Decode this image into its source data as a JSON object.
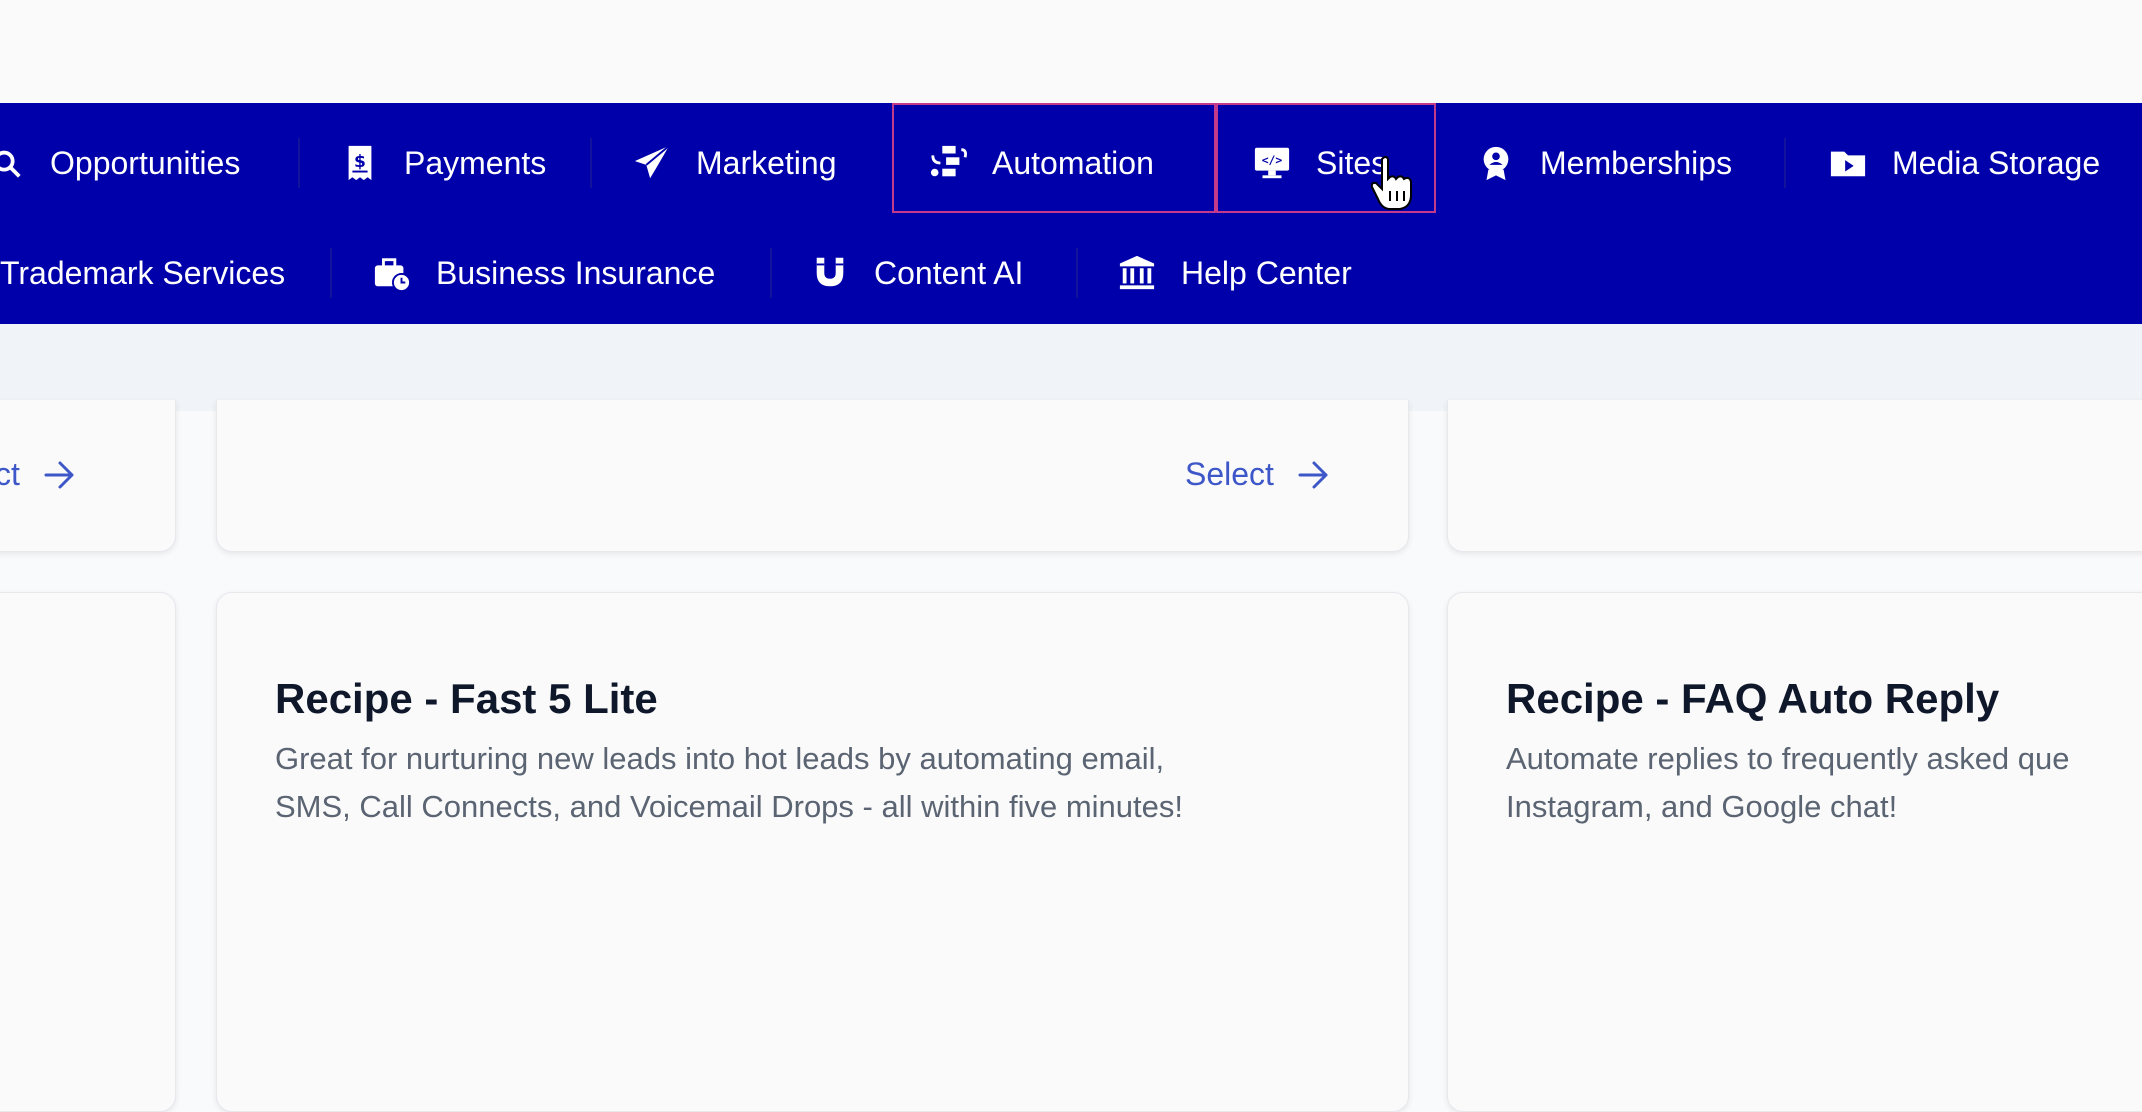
{
  "nav": {
    "row1": [
      {
        "label": "Opportunities",
        "icon": "opportunities-icon"
      },
      {
        "label": "Payments",
        "icon": "receipt-dollar-icon"
      },
      {
        "label": "Marketing",
        "icon": "paper-plane-icon"
      },
      {
        "label": "Automation",
        "icon": "workflow-icon"
      },
      {
        "label": "Sites",
        "icon": "monitor-code-icon"
      },
      {
        "label": "Memberships",
        "icon": "badge-icon"
      },
      {
        "label": "Media Storage",
        "icon": "folder-play-icon"
      }
    ],
    "row2": [
      {
        "label": "Trademark Services",
        "icon": ""
      },
      {
        "label": "Business Insurance",
        "icon": "briefcase-clock-icon"
      },
      {
        "label": "Content AI",
        "icon": "magnet-icon"
      },
      {
        "label": "Help Center",
        "icon": "bank-icon"
      }
    ],
    "hovered": "Sites",
    "colors": {
      "bar": "#0000aa",
      "highlight": "#c23b8a"
    }
  },
  "cards_top": [
    {
      "select_label": "Select"
    },
    {
      "select_label": "Select"
    }
  ],
  "cards": [
    {
      "title": "Recipe - Fast 5 Lite",
      "desc_line1": "Great for nurturing new leads into hot leads by automating email,",
      "desc_line2": "SMS, Call Connects, and Voicemail Drops - all within five minutes!"
    },
    {
      "title": "Recipe - FAQ Auto Reply",
      "desc_line1": "Automate replies to frequently asked que",
      "desc_line2": "Instagram, and Google chat!"
    }
  ],
  "colors": {
    "link": "#3d57c9",
    "title": "#0f172a",
    "desc": "#5b6472"
  }
}
